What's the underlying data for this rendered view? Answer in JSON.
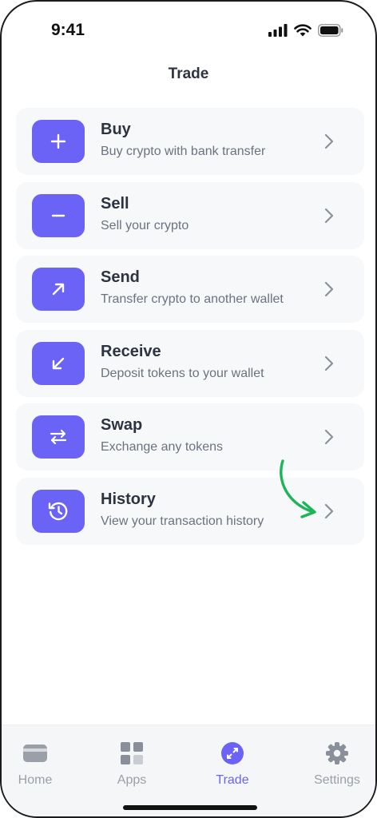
{
  "status_bar": {
    "time": "9:41"
  },
  "page": {
    "title": "Trade"
  },
  "actions": [
    {
      "title": "Buy",
      "subtitle": "Buy crypto with bank transfer",
      "icon": "plus-icon"
    },
    {
      "title": "Sell",
      "subtitle": "Sell your crypto",
      "icon": "minus-icon"
    },
    {
      "title": "Send",
      "subtitle": "Transfer crypto to another wallet",
      "icon": "arrow-up-right-icon"
    },
    {
      "title": "Receive",
      "subtitle": "Deposit tokens to your wallet",
      "icon": "arrow-down-left-icon"
    },
    {
      "title": "Swap",
      "subtitle": "Exchange any tokens",
      "icon": "swap-arrows-icon"
    },
    {
      "title": "History",
      "subtitle": "View your transaction history",
      "icon": "history-clock-icon"
    }
  ],
  "tab_bar": {
    "tabs": [
      {
        "label": "Home",
        "icon": "wallet-card-icon",
        "active": false
      },
      {
        "label": "Apps",
        "icon": "apps-grid-icon",
        "active": false
      },
      {
        "label": "Trade",
        "icon": "trade-arrows-icon",
        "active": true
      },
      {
        "label": "Settings",
        "icon": "gear-icon",
        "active": false
      }
    ]
  },
  "colors": {
    "accent": "#6a63f5",
    "row_background": "#f7f8fa",
    "annotation_arrow": "#1fb35a"
  }
}
